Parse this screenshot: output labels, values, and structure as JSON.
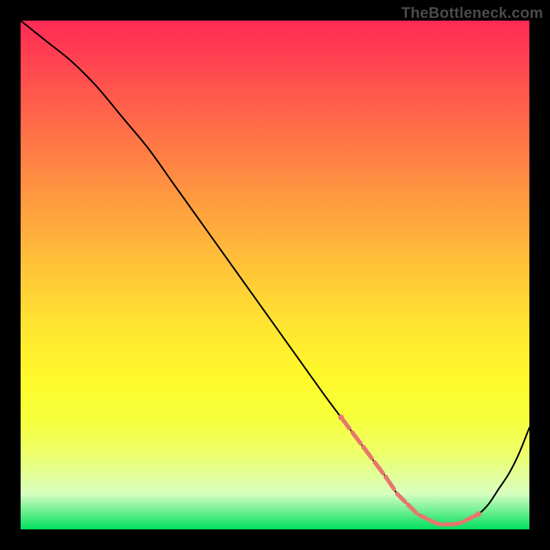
{
  "watermark": "TheBottleneck.com",
  "colors": {
    "frame": "#000000",
    "curve": "#000000",
    "markers": "#e7766f"
  },
  "chart_data": {
    "type": "line",
    "title": "",
    "xlabel": "",
    "ylabel": "",
    "xlim": [
      0,
      100
    ],
    "ylim": [
      0,
      100
    ],
    "grid": false,
    "legend": false,
    "gradient_stops": [
      {
        "pos": 0.0,
        "color": "#ff2a55"
      },
      {
        "pos": 0.1,
        "color": "#ff4a4f"
      },
      {
        "pos": 0.2,
        "color": "#ff6a49"
      },
      {
        "pos": 0.3,
        "color": "#ff8a43"
      },
      {
        "pos": 0.4,
        "color": "#ffa93d"
      },
      {
        "pos": 0.5,
        "color": "#ffc837"
      },
      {
        "pos": 0.6,
        "color": "#ffe531"
      },
      {
        "pos": 0.7,
        "color": "#fff92b"
      },
      {
        "pos": 0.78,
        "color": "#f6ff3a"
      },
      {
        "pos": 0.85,
        "color": "#eeff6a"
      },
      {
        "pos": 0.93,
        "color": "#d8ffc0"
      },
      {
        "pos": 1.0,
        "color": "#00e060"
      }
    ],
    "series": [
      {
        "name": "bottleneck-curve",
        "x": [
          0,
          5,
          10,
          15,
          20,
          25,
          30,
          35,
          40,
          45,
          50,
          55,
          60,
          63,
          66,
          69,
          72,
          74,
          76,
          78,
          80,
          82,
          84,
          86,
          88,
          90,
          92,
          94,
          96,
          98,
          100
        ],
        "y": [
          100,
          96,
          92,
          87,
          81,
          75,
          68,
          61,
          54,
          47,
          40,
          33,
          26,
          22,
          18,
          14,
          10,
          7,
          5,
          3,
          2,
          1,
          1,
          1,
          2,
          3,
          5,
          8,
          11,
          15,
          20
        ]
      }
    ],
    "highlight_band": {
      "x_start": 63,
      "x_end": 90,
      "style": "dots-and-segments"
    }
  }
}
